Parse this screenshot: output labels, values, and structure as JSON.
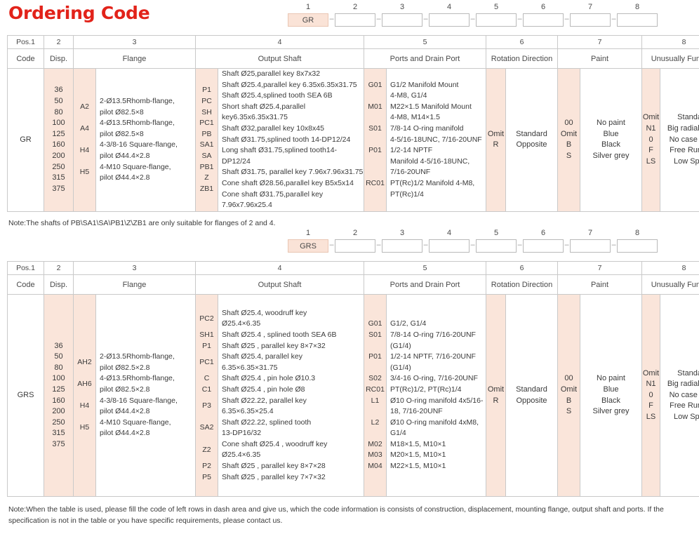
{
  "title": "Ordering Code",
  "colors": {
    "title": "#e2231a",
    "shade": "#fae5da",
    "border": "#c9c9c9",
    "filled_box": "#fae3d7"
  },
  "code_strip_1": {
    "numbers": [
      "1",
      "2",
      "3",
      "4",
      "5",
      "6",
      "7",
      "8"
    ],
    "values": [
      "GR",
      "",
      "",
      "",
      "",
      "",
      "",
      ""
    ],
    "separator": "–"
  },
  "code_strip_2": {
    "numbers": [
      "1",
      "2",
      "3",
      "4",
      "5",
      "6",
      "7",
      "8"
    ],
    "values": [
      "GRS",
      "",
      "",
      "",
      "",
      "",
      "",
      ""
    ],
    "separator": "–"
  },
  "headers": {
    "pos_row": [
      "Pos.1",
      "2",
      "3",
      "4",
      "5",
      "6",
      "7",
      "8"
    ],
    "label_row": [
      "Code",
      "Disp.",
      "Flange",
      "Output Shaft",
      "Ports and Drain Port",
      "Rotation Direction",
      "Paint",
      "Unusually Function"
    ]
  },
  "table1": {
    "code": "GR",
    "displacements": [
      "36",
      "50",
      "80",
      "100",
      "125",
      "160",
      "200",
      "250",
      "315",
      "375"
    ],
    "flange": [
      {
        "code": "A2",
        "text": "2-Ø13.5Rhomb-flange,\npilot Ø82.5×8"
      },
      {
        "code": "A4",
        "text": "4-Ø13.5Rhomb-flange,\npilot Ø82.5×8"
      },
      {
        "code": "H4",
        "text": "4-3/8-16 Square-flange,\npilot Ø44.4×2.8"
      },
      {
        "code": "H5",
        "text": "4-M10 Square-flange,\npilot Ø44.4×2.8"
      }
    ],
    "output_shaft": [
      {
        "code": "P1",
        "text": "Shaft Ø25,parallel key 8x7x32"
      },
      {
        "code": "PC",
        "text": "Shaft Ø25.4,parallel key 6.35x6.35x31.75"
      },
      {
        "code": "SH",
        "text": "Shaft Ø25.4,splined tooth SEA 6B"
      },
      {
        "code": "PC1",
        "text": "Short shaft Ø25.4,parallel key6.35x6.35x31.75"
      },
      {
        "code": "PB",
        "text": "Shaft Ø32,parallel key 10x8x45"
      },
      {
        "code": "SA1",
        "text": "Shaft Ø31.75,splined tooth 14-DP12/24"
      },
      {
        "code": "SA",
        "text": "Long shaft Ø31.75,splined tooth14-DP12/24"
      },
      {
        "code": "PB1",
        "text": "Shaft Ø31.75, parallel key 7.96x7.96x31.75"
      },
      {
        "code": "Z",
        "text": "Cone shaft Ø28.56,parallel key B5x5x14"
      },
      {
        "code": "ZB1",
        "text": "Cone shaft Ø31.75,parallel key 7.96x7.96x25.4"
      }
    ],
    "ports": [
      {
        "code": "G01",
        "text": "G1/2 Manifold Mount\n4-M8, G1/4"
      },
      {
        "code": "M01",
        "text": "M22×1.5 Manifold Mount\n4-M8, M14×1.5"
      },
      {
        "code": "S01",
        "text": "7/8-14 O-ring manifold\n4-5/16-18UNC, 7/16-20UNF"
      },
      {
        "code": "P01",
        "text": "1/2-14 NPTF\nManifold 4-5/16-18UNC,\n7/16-20UNF"
      },
      {
        "code": "RC01",
        "text": "PT(Rc)1/2 Manifold 4-M8,\nPT(Rc)1/4"
      }
    ],
    "rotation": {
      "codes": [
        "Omit",
        "R"
      ],
      "values": [
        "Standard",
        "Opposite"
      ]
    },
    "paint": {
      "codes": [
        "00",
        "Omit",
        "B",
        "S"
      ],
      "values": [
        "No paint",
        "Blue",
        "Black",
        "Silver grey"
      ]
    },
    "function": {
      "codes": [
        "Omit",
        "N1",
        "0",
        "F",
        "LS"
      ],
      "values": [
        "Standard",
        "Big radial force",
        "No case drain",
        "Free Running",
        "Low Speed"
      ]
    }
  },
  "note1": "Note:The shafts of PB\\SA1\\SA\\PB1\\Z\\ZB1 are only suitable for flanges of 2 and 4.",
  "table2": {
    "code": "GRS",
    "displacements": [
      "36",
      "50",
      "80",
      "100",
      "125",
      "160",
      "200",
      "250",
      "315",
      "375"
    ],
    "flange": [
      {
        "code": "AH2",
        "text": "2-Ø13.5Rhomb-flange,\npilot Ø82.5×2.8"
      },
      {
        "code": "AH6",
        "text": "4-Ø13.5Rhomb-flange,\npilot Ø82.5×2.8"
      },
      {
        "code": "H4",
        "text": "4-3/8-16 Square-flange,\npilot Ø44.4×2.8"
      },
      {
        "code": "H5",
        "text": "4-M10 Square-flange,\npilot Ø44.4×2.8"
      }
    ],
    "output_shaft": [
      {
        "code": "PC2",
        "text": "Shaft Ø25.4, woodruff key\nØ25.4×6.35"
      },
      {
        "code": "SH1",
        "text": "Shaft Ø25.4 , splined tooth SEA 6B"
      },
      {
        "code": "P1",
        "text": "Shaft Ø25 ,  parallel key 8×7×32"
      },
      {
        "code": "PC1",
        "text": "Shaft Ø25.4, parallel key\n6.35×6.35×31.75"
      },
      {
        "code": "C",
        "text": "Shaft Ø25.4 , pin hole Ø10.3"
      },
      {
        "code": "C1",
        "text": "Shaft Ø25.4 , pin hole Ø8"
      },
      {
        "code": "P3",
        "text": "Shaft Ø22.22, parallel key\n6.35×6.35×25.4"
      },
      {
        "code": "SA2",
        "text": "Shaft Ø22.22, splined tooth\n13-DP16/32"
      },
      {
        "code": "Z2",
        "text": "Cone shaft Ø25.4 , woodruff key\nØ25.4×6.35"
      },
      {
        "code": "P2",
        "text": "Shaft Ø25 ,  parallel key 8×7×28"
      },
      {
        "code": "P5",
        "text": "Shaft Ø25 ,  parallel key 7×7×32"
      }
    ],
    "ports": [
      {
        "code": "G01",
        "text": "G1/2, G1/4"
      },
      {
        "code": "S01",
        "text": "7/8-14 O-ring 7/16-20UNF\n(G1/4)"
      },
      {
        "code": "P01",
        "text": "1/2-14 NPTF, 7/16-20UNF\n(G1/4)"
      },
      {
        "code": "S02",
        "text": "3/4-16 O-ring, 7/16-20UNF"
      },
      {
        "code": "RC01",
        "text": "PT(Rc)1/2, PT(Rc)1/4"
      },
      {
        "code": "L1",
        "text": "Ø10 O-ring manifold 4x5/16-\n18, 7/16-20UNF"
      },
      {
        "code": "L2",
        "text": "Ø10 O-ring manifold 4xM8,\nG1/4"
      },
      {
        "code": "M02",
        "text": "M18×1.5, M10×1"
      },
      {
        "code": "M03",
        "text": "M20×1.5, M10×1"
      },
      {
        "code": "M04",
        "text": "M22×1.5, M10×1"
      }
    ],
    "rotation": {
      "codes": [
        "Omit",
        "R"
      ],
      "values": [
        "Standard",
        "Opposite"
      ]
    },
    "paint": {
      "codes": [
        "00",
        "Omit",
        "B",
        "S"
      ],
      "values": [
        "No paint",
        "Blue",
        "Black",
        "Silver grey"
      ]
    },
    "function": {
      "codes": [
        "Omit",
        "N1",
        "0",
        "F",
        "LS"
      ],
      "values": [
        "Standard",
        "Big radial force",
        "No case drain",
        "Free Running",
        "Low Speed"
      ]
    }
  },
  "note2": "Note:When the table is used, please fill the code of left rows in dash area and give us, which the code information is consists of construction, displacement, mounting flange, output shaft and ports. If the specification is not in the table or you have specific requirements, please contact us."
}
